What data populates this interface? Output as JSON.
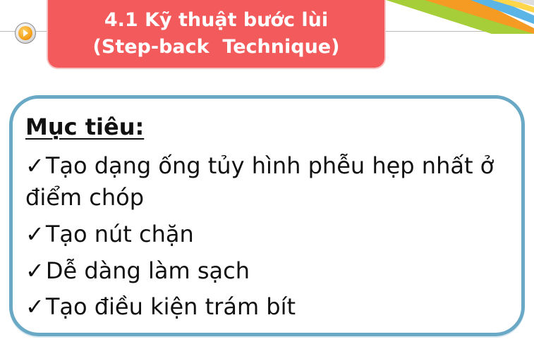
{
  "title": {
    "line1": "4.1 Kỹ thuật bước lùi",
    "line2": "(Step-back  Technique)"
  },
  "content": {
    "heading": "Mục tiêu:",
    "check_glyph": "✓",
    "bullets": [
      {
        "line1": "Tạo dạng ống tủy hình phễu hẹp nhất ở",
        "line2": "điểm chóp"
      },
      {
        "line1": "Tạo nút chặn"
      },
      {
        "line1": "Dễ dàng làm sạch"
      },
      {
        "line1": "Tạo điều kiện trám bít"
      }
    ]
  },
  "icons": {
    "nav_button": "arrow-right-icon"
  },
  "colors": {
    "title_background": "#f25a5c",
    "title_text": "#ffffff",
    "content_border": "#6aa9c6",
    "deco_orange": "#f59a22",
    "deco_green": "#a6ce39",
    "deco_blue": "#5ab4e5"
  }
}
